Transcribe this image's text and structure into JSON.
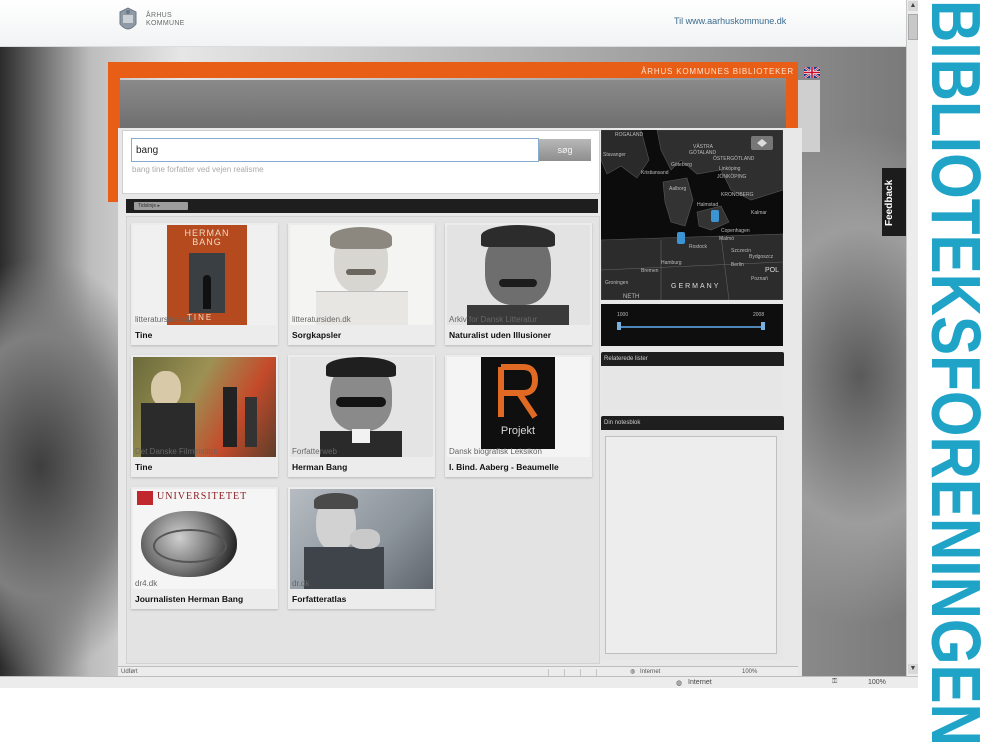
{
  "header": {
    "municipality_crest_text": [
      "ÅRHUS",
      "KOMMUNE"
    ],
    "external_link": "Til www.aarhuskommune.dk"
  },
  "app": {
    "library_title": "ÅRHUS KOMMUNES BIBLIOTEKER"
  },
  "search": {
    "query": "bang",
    "button_label": "søg",
    "suggestion": "bang tine forfatter ved vejen realisme"
  },
  "results_tab_label": "Tidslinje ▸",
  "results": [
    {
      "source": "litteratursiden.dk",
      "title": "Tine",
      "thumb": "book-cover-icon"
    },
    {
      "source": "litteratursiden.dk",
      "title": "Sorgkapsler",
      "thumb": "portrait-sketch-icon"
    },
    {
      "source": "Arkiv for Dansk Litteratur",
      "title": "Naturalist uden Illusioner",
      "thumb": "portrait-photo-icon"
    },
    {
      "source": "Det Danske Filminstitut",
      "title": "Tine",
      "thumb": "film-still-icon"
    },
    {
      "source": "Forfatterweb",
      "title": "Herman Bang",
      "thumb": "portrait-photo-icon"
    },
    {
      "source": "Dansk biografisk Leksikon",
      "title": "I. Bind. Aaberg - Beaumelle",
      "thumb": "projekt-logo-icon"
    },
    {
      "source": "dr4.dk",
      "title": "Journalisten Herman Bang",
      "thumb": "university-logo-icon"
    },
    {
      "source": "dr.dk",
      "title": "Forfatteratlas",
      "thumb": "portrait-photo-icon"
    }
  ],
  "thumb_text": {
    "book": [
      "HERMAN",
      "BANG"
    ],
    "book_bottom": "TINE",
    "projekt_word": "Projekt",
    "university_word": "UNIVERSITETET"
  },
  "map": {
    "country_label": "GERMANY",
    "country_label_2": "POL",
    "region_labels": [
      "ROGALAND",
      "Stavanger",
      "VÄSTRA",
      "GÖTALAND",
      "ÖSTERGÖTLAND",
      "Göteborg",
      "JÖNKÖPING",
      "Aalborg",
      "KRONOBERG",
      "Kalmar",
      "Copenhagen",
      "Hamburg",
      "Bremen",
      "Groningen",
      "Berlin",
      "Poznań",
      "NETH",
      "Kristiansand",
      "Linköping",
      "Halmstad",
      "Malmö",
      "Rostock",
      "Szczecin",
      "Bydgoszcz"
    ]
  },
  "timeline": {
    "start": "1000",
    "end": "2008"
  },
  "panels": {
    "related_lists": "Relaterede lister",
    "notepad": "Din notesblok"
  },
  "feedback_label": "Feedback",
  "status": {
    "inner_left": "Udført",
    "inner_zone": "Internet",
    "inner_zoom": "100%",
    "outer_zone": "Internet",
    "outer_zoom": "100%"
  },
  "banner_text": "BIBLIOTEKSFORENINGEN",
  "colors": {
    "accent_orange": "#e85e16",
    "banner_teal": "#1fa4c8",
    "map_pin": "#3d94d3"
  }
}
